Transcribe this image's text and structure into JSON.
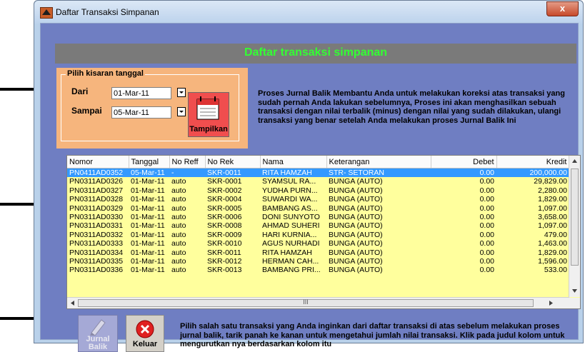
{
  "window": {
    "title": "Daftar Transaksi Simpanan",
    "close_label": "x"
  },
  "banner": {
    "title": "Daftar transaksi simpanan"
  },
  "date_range": {
    "legend": "Pilih kisaran tanggal",
    "from_label": "Dari",
    "from_value": "01-Mar-11",
    "to_label": "Sampai",
    "to_value": "05-Mar-11",
    "show_button": "Tampilkan"
  },
  "info_top": "Proses Jurnal Balik Membantu Anda untuk melakukan koreksi atas transaksi yang sudah pernah Anda lakukan sebelumnya, Proses ini akan menghasilkan sebuah transaksi dengan nilai terbalik (minus) dengan nilai yang sudah dilakukan, ulangi transaksi yang benar setelah Anda melakukan proses Jurnal Balik Ini",
  "table": {
    "columns": [
      "Nomor",
      "Tanggal",
      "No Reff",
      "No Rek",
      "Nama",
      "Keterangan",
      "Debet",
      "Kredit"
    ],
    "rows": [
      [
        "PN0411AD0352",
        "05-Mar-11",
        "-",
        "SKR-0011",
        "RITA HAMZAH",
        "STR- SETORAN",
        "0.00",
        "200,000.00"
      ],
      [
        "PN0311AD0326",
        "01-Mar-11",
        "auto",
        "SKR-0001",
        "SYAMSUL RA...",
        "BUNGA (AUTO)",
        "0.00",
        "29,829.00"
      ],
      [
        "PN0311AD0327",
        "01-Mar-11",
        "auto",
        "SKR-0002",
        "YUDHA PURN...",
        "BUNGA (AUTO)",
        "0.00",
        "2,280.00"
      ],
      [
        "PN0311AD0328",
        "01-Mar-11",
        "auto",
        "SKR-0004",
        "SUWARDI WA...",
        "BUNGA (AUTO)",
        "0.00",
        "1,829.00"
      ],
      [
        "PN0311AD0329",
        "01-Mar-11",
        "auto",
        "SKR-0005",
        "BAMBANG AS...",
        "BUNGA (AUTO)",
        "0.00",
        "1,097.00"
      ],
      [
        "PN0311AD0330",
        "01-Mar-11",
        "auto",
        "SKR-0006",
        "DONI SUNYOTO",
        "BUNGA (AUTO)",
        "0.00",
        "3,658.00"
      ],
      [
        "PN0311AD0331",
        "01-Mar-11",
        "auto",
        "SKR-0008",
        "AHMAD SUHERI",
        "BUNGA (AUTO)",
        "0.00",
        "1,097.00"
      ],
      [
        "PN0311AD0332",
        "01-Mar-11",
        "auto",
        "SKR-0009",
        "HARI KURNIA...",
        "BUNGA (AUTO)",
        "0.00",
        "479.00"
      ],
      [
        "PN0311AD0333",
        "01-Mar-11",
        "auto",
        "SKR-0010",
        "AGUS NURHADI",
        "BUNGA (AUTO)",
        "0.00",
        "1,463.00"
      ],
      [
        "PN0311AD0334",
        "01-Mar-11",
        "auto",
        "SKR-0011",
        "RITA HAMZAH",
        "BUNGA (AUTO)",
        "0.00",
        "1,829.00"
      ],
      [
        "PN0311AD0335",
        "01-Mar-11",
        "auto",
        "SKR-0012",
        "HERMAN CAH...",
        "BUNGA (AUTO)",
        "0.00",
        "1,596.00"
      ],
      [
        "PN0311AD0336",
        "01-Mar-11",
        "auto",
        "SKR-0013",
        "BAMBANG PRI...",
        "BUNGA (AUTO)",
        "0.00",
        "533.00"
      ]
    ],
    "hscroll_mark": "III"
  },
  "buttons": {
    "jurnal_balik": "Jurnal Balik",
    "keluar": "Keluar"
  },
  "info_bottom": "Pilih salah satu transaksi yang Anda inginkan dari daftar transaksi di atas sebelum melakukan proses jurnal balik, tarik panah ke kanan untuk mengetahui jumlah nilai transaksi. Klik pada judul kolom untuk mengurutkan nya berdasarkan kolom itu",
  "colors": {
    "client_bg": "#6f7ec2",
    "banner_text": "#33ff33",
    "grid_bg": "#ffff9d",
    "selection": "#3399ff",
    "date_panel": "#f6b57d"
  }
}
